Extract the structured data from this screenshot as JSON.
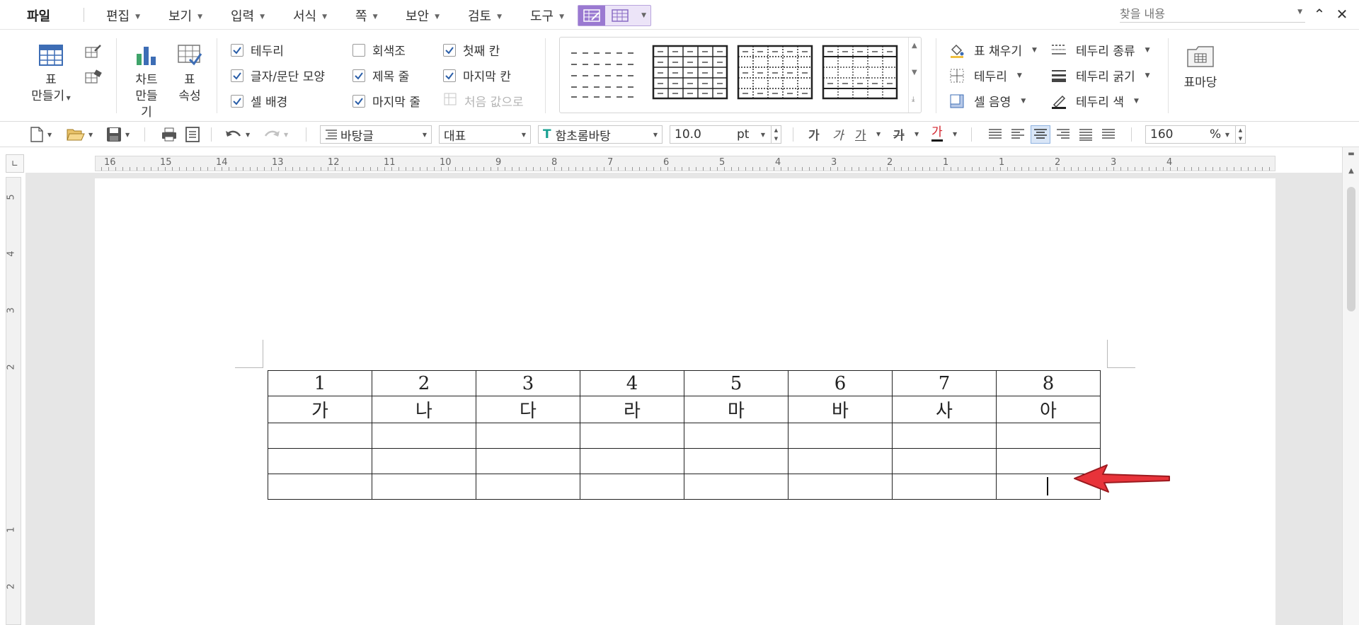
{
  "menu": {
    "file": "파일",
    "items": [
      "편집",
      "보기",
      "입력",
      "서식",
      "쪽",
      "보안",
      "검토",
      "도구"
    ],
    "search_placeholder": "찾을 내용"
  },
  "ribbon": {
    "table_make": "표\n만들기",
    "chart_make": "차트\n만들기",
    "table_props": "표\n속성",
    "checks": {
      "border": "테두리",
      "char_para": "글자/문단 모양",
      "cell_bg": "셀 배경",
      "grayscale": "회색조",
      "title_row": "제목 줄",
      "last_row": "마지막 줄",
      "first_col": "첫째 칸",
      "last_col": "마지막 칸",
      "reset": "처음 값으로"
    },
    "fill": "표 채우기",
    "border_btn": "테두리",
    "cell_shade": "셀 음영",
    "border_type": "테두리 종류",
    "border_weight": "테두리 굵기",
    "border_color": "테두리 색",
    "table_style": "표마당"
  },
  "toolbar": {
    "style": "바탕글",
    "lang": "대표",
    "font": "함초롬바탕",
    "size": "10.0",
    "size_unit": "pt",
    "zoom": "160",
    "zoom_unit": "%",
    "bold": "가",
    "italic": "가",
    "underline": "가",
    "strike": "가",
    "color": "가"
  },
  "ruler": {
    "h_labels": [
      "16",
      "15",
      "14",
      "13",
      "12",
      "11",
      "10",
      "9",
      "8",
      "7",
      "6",
      "5",
      "4",
      "3",
      "2",
      "1",
      "1",
      "2",
      "3",
      "4"
    ],
    "v_labels": [
      "5",
      "4",
      "3",
      "2",
      "1",
      "2"
    ]
  },
  "table": {
    "rows": [
      [
        "1",
        "2",
        "3",
        "4",
        "5",
        "6",
        "7",
        "8"
      ],
      [
        "가",
        "나",
        "다",
        "라",
        "마",
        "바",
        "사",
        "아"
      ],
      [
        "",
        "",
        "",
        "",
        "",
        "",
        "",
        ""
      ],
      [
        "",
        "",
        "",
        "",
        "",
        "",
        "",
        ""
      ],
      [
        "",
        "",
        "",
        "",
        "",
        "",
        "",
        ""
      ]
    ]
  },
  "colors": {
    "accent_purple": "#9a79d1",
    "arrow_red": "#e8333a"
  }
}
